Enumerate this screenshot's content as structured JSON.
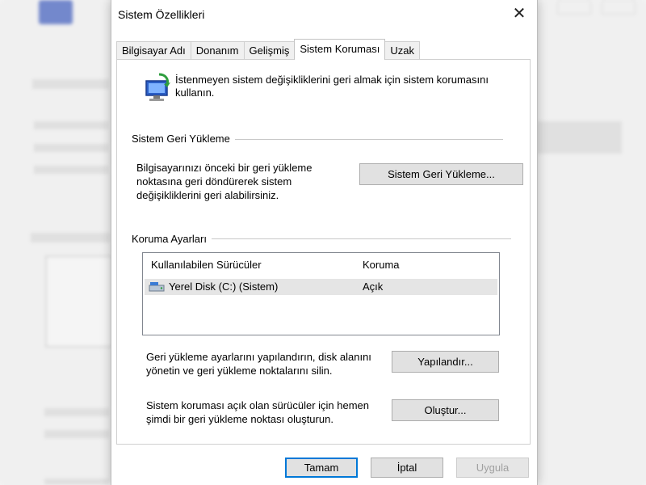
{
  "window": {
    "title": "Sistem Özellikleri",
    "close_glyph": "✕"
  },
  "tabs": [
    {
      "label": "Bilgisayar Adı",
      "active": false
    },
    {
      "label": "Donanım",
      "active": false
    },
    {
      "label": "Gelişmiş",
      "active": false
    },
    {
      "label": "Sistem Koruması",
      "active": true
    },
    {
      "label": "Uzak",
      "active": false
    }
  ],
  "intro": {
    "icon": "system-protection-icon",
    "line1": "İstenmeyen sistem değişikliklerini geri almak için sistem korumasını",
    "line2": "kullanın."
  },
  "restore": {
    "section_label": "Sistem Geri Yükleme",
    "text_lines": [
      "Bilgisayarınızı önceki bir geri yükleme",
      "noktasına geri döndürerek sistem",
      "değişikliklerini geri alabilirsiniz."
    ],
    "button_label": "Sistem Geri Yükleme..."
  },
  "protection": {
    "section_label": "Koruma Ayarları",
    "columns": [
      "Kullanılabilen Sürücüler",
      "Koruma"
    ],
    "rows": [
      {
        "drive": "Yerel Disk (C:) (Sistem)",
        "status": "Açık",
        "icon": "hard-disk-icon"
      }
    ],
    "configure_text_lines": [
      "Geri yükleme ayarlarını yapılandırın, disk alanını",
      "yönetin ve geri yükleme noktalarını silin."
    ],
    "configure_button": "Yapılandır...",
    "create_text_lines": [
      "Sistem koruması açık olan sürücüler için hemen",
      "şimdi bir geri yükleme noktası oluşturun."
    ],
    "create_button": "Oluştur..."
  },
  "footer": {
    "ok": "Tamam",
    "cancel": "İptal",
    "apply": "Uygula"
  },
  "colors": {
    "accent": "#0078d7",
    "selected_row": "#e5e5e5"
  }
}
